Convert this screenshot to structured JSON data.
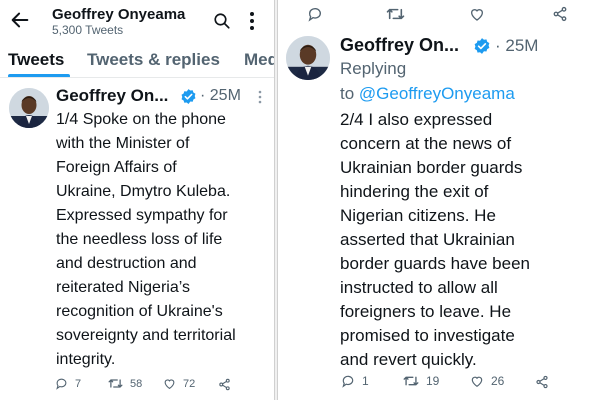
{
  "left": {
    "header": {
      "title": "Geoffrey Onyeama",
      "subtitle": "5,300 Tweets",
      "back_icon": "arrow-left-icon",
      "search_icon": "search-icon",
      "more_icon": "more-vertical-icon"
    },
    "tabs": [
      {
        "label": "Tweets",
        "active": true
      },
      {
        "label": "Tweets & replies",
        "active": false
      },
      {
        "label": "Media",
        "active": false
      }
    ],
    "tweet": {
      "name": "Geoffrey On...",
      "time": "· 25M",
      "text": "1/4 Spoke on the phone\nwith the Minister of\nForeign Affairs of\nUkraine, Dmytro Kuleba.\nExpressed sympathy for\nthe needless loss of life\nand destruction and\nreiterated Nigeria’s\nrecognition of Ukraine's\nsovereignty and territorial\nintegrity.",
      "replies": "7",
      "retweets": "58",
      "likes": "72"
    }
  },
  "right": {
    "tweet": {
      "name": "Geoffrey On...",
      "time": "· 25M",
      "replying_label": "Replying",
      "replying_to": "to",
      "replying_handle": "@GeoffreyOnyeama",
      "text": "2/4 I also expressed\nconcern at the news of\nUkrainian border guards\nhindering the exit of\nNigerian citizens. He\nasserted that Ukrainian\nborder guards have been\ninstructed to allow all\nforeigners to leave. He\npromised to investigate\nand revert quickly.",
      "replies": "1",
      "retweets": "19",
      "likes": "26"
    }
  },
  "colors": {
    "accent": "#1d9bf0",
    "text": "#0f1419",
    "muted": "#536471",
    "verified": "#1d9bf0"
  }
}
